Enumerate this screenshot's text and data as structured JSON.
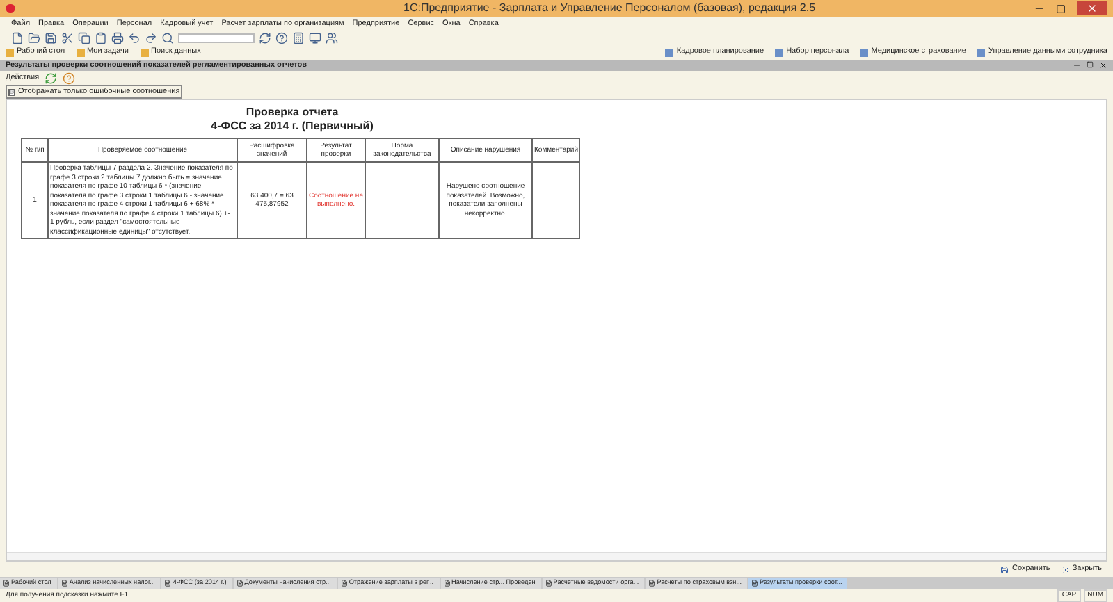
{
  "window": {
    "title": "1С:Предприятие - Зарплата и Управление Персоналом (базовая), редакция 2.5"
  },
  "menu": [
    "Файл",
    "Правка",
    "Операции",
    "Персонал",
    "Кадровый учет",
    "Расчет зарплаты по организациям",
    "Предприятие",
    "Сервис",
    "Окна",
    "Справка"
  ],
  "panel_left": [
    "Рабочий стол",
    "Мои задачи",
    "Поиск данных"
  ],
  "panel_right": [
    "Кадровое планирование",
    "Набор персонала",
    "Медицинское страхование",
    "Управление данными сотрудника"
  ],
  "document": {
    "title": "Результаты проверки соотношений показателей регламентированных отчетов",
    "actions": "Действия",
    "filter": {
      "label": "Отображать только ошибочные соотношения",
      "checked": true
    },
    "report_title": [
      "Проверка отчета",
      "4-ФСС за 2014 г. (Первичный)"
    ],
    "columns": [
      "№ п/п",
      "Проверяемое соотношение",
      "Расшифровка значений",
      "Результат проверки",
      "Норма законодательства",
      "Описание нарушения",
      "Комментарий"
    ],
    "rows": [
      {
        "cells": [
          "1",
          "Проверка таблицы 7 раздела 2. Значение показателя по графе 3 строки 2 таблицы 7 должно быть = значение показателя по графе 10 таблицы 6 * (значение показателя по графе 3 строки 1 таблицы 6 - значение показателя по графе 4 строки 1 таблицы 6 + 68% * значение показателя по графе 4 строки 1 таблицы 6) +- 1 рубль, если раздел \"самостоятельные классификационные единицы\" отсутствует.",
          "63 400,7 = 63 475,87952",
          "Соотношение не выполнено.",
          "",
          "Нарушено соотношение показателей. Возможно, показатели заполнены некорректно.",
          ""
        ],
        "failed": true
      }
    ],
    "buttons": [
      "Сохранить",
      "Закрыть"
    ]
  },
  "taskbar": [
    {
      "label": "Рабочий стол",
      "selected": false
    },
    {
      "label": "Анализ начисленных налог...",
      "selected": false
    },
    {
      "label": "4-ФСС (за 2014 г.)",
      "selected": false
    },
    {
      "label": "Документы начисления стр...",
      "selected": false
    },
    {
      "label": "Отражение зарплаты в рег...",
      "selected": false
    },
    {
      "label": "Начисление стр... Проведен",
      "selected": false
    },
    {
      "label": "Расчетные ведомости орга...",
      "selected": false
    },
    {
      "label": "Расчеты по страховым взн...",
      "selected": false
    },
    {
      "label": "Результаты проверки соот...",
      "selected": true
    }
  ],
  "status_bar": {
    "hint": "Для получения подсказки нажмите F1",
    "indicators": [
      "CAP",
      "NUM"
    ]
  }
}
